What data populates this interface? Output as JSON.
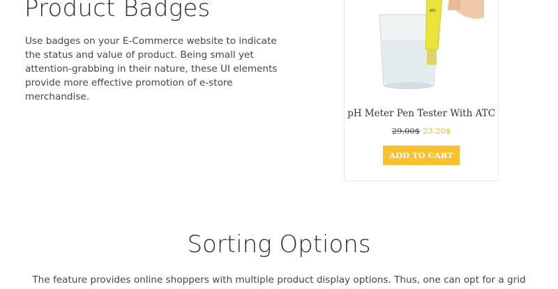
{
  "badges_section": {
    "title": "Product Badges",
    "description": "Use badges on your E-Commerce website to indicate the status and value of product. Being small yet attention-grabbing in their nature, these UI elements provide more effective promotion of e-store merchandise."
  },
  "product": {
    "image_icon": "ph-meter-in-glass",
    "image_label": "ATC",
    "name": "pH Meter Pen Tester With ATC",
    "old_price": "29.00$",
    "new_price": "23.20$",
    "cart_button_label": "ADD TO CART"
  },
  "sorting_section": {
    "title": "Sorting Options",
    "description": "The feature provides online shoppers with multiple product display options. Thus, one can opt for a grid"
  },
  "colors": {
    "accent": "#fbc02d",
    "sale_price": "#f7b928",
    "text": "#444444"
  }
}
